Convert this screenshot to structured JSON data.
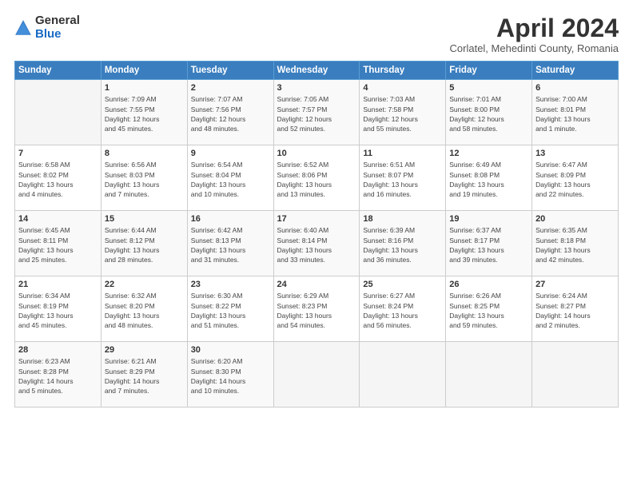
{
  "header": {
    "logo_general": "General",
    "logo_blue": "Blue",
    "title": "April 2024",
    "subtitle": "Corlatel, Mehedinti County, Romania"
  },
  "weekdays": [
    "Sunday",
    "Monday",
    "Tuesday",
    "Wednesday",
    "Thursday",
    "Friday",
    "Saturday"
  ],
  "weeks": [
    [
      {
        "day": "",
        "info": ""
      },
      {
        "day": "1",
        "info": "Sunrise: 7:09 AM\nSunset: 7:55 PM\nDaylight: 12 hours\nand 45 minutes."
      },
      {
        "day": "2",
        "info": "Sunrise: 7:07 AM\nSunset: 7:56 PM\nDaylight: 12 hours\nand 48 minutes."
      },
      {
        "day": "3",
        "info": "Sunrise: 7:05 AM\nSunset: 7:57 PM\nDaylight: 12 hours\nand 52 minutes."
      },
      {
        "day": "4",
        "info": "Sunrise: 7:03 AM\nSunset: 7:58 PM\nDaylight: 12 hours\nand 55 minutes."
      },
      {
        "day": "5",
        "info": "Sunrise: 7:01 AM\nSunset: 8:00 PM\nDaylight: 12 hours\nand 58 minutes."
      },
      {
        "day": "6",
        "info": "Sunrise: 7:00 AM\nSunset: 8:01 PM\nDaylight: 13 hours\nand 1 minute."
      }
    ],
    [
      {
        "day": "7",
        "info": "Sunrise: 6:58 AM\nSunset: 8:02 PM\nDaylight: 13 hours\nand 4 minutes."
      },
      {
        "day": "8",
        "info": "Sunrise: 6:56 AM\nSunset: 8:03 PM\nDaylight: 13 hours\nand 7 minutes."
      },
      {
        "day": "9",
        "info": "Sunrise: 6:54 AM\nSunset: 8:04 PM\nDaylight: 13 hours\nand 10 minutes."
      },
      {
        "day": "10",
        "info": "Sunrise: 6:52 AM\nSunset: 8:06 PM\nDaylight: 13 hours\nand 13 minutes."
      },
      {
        "day": "11",
        "info": "Sunrise: 6:51 AM\nSunset: 8:07 PM\nDaylight: 13 hours\nand 16 minutes."
      },
      {
        "day": "12",
        "info": "Sunrise: 6:49 AM\nSunset: 8:08 PM\nDaylight: 13 hours\nand 19 minutes."
      },
      {
        "day": "13",
        "info": "Sunrise: 6:47 AM\nSunset: 8:09 PM\nDaylight: 13 hours\nand 22 minutes."
      }
    ],
    [
      {
        "day": "14",
        "info": "Sunrise: 6:45 AM\nSunset: 8:11 PM\nDaylight: 13 hours\nand 25 minutes."
      },
      {
        "day": "15",
        "info": "Sunrise: 6:44 AM\nSunset: 8:12 PM\nDaylight: 13 hours\nand 28 minutes."
      },
      {
        "day": "16",
        "info": "Sunrise: 6:42 AM\nSunset: 8:13 PM\nDaylight: 13 hours\nand 31 minutes."
      },
      {
        "day": "17",
        "info": "Sunrise: 6:40 AM\nSunset: 8:14 PM\nDaylight: 13 hours\nand 33 minutes."
      },
      {
        "day": "18",
        "info": "Sunrise: 6:39 AM\nSunset: 8:16 PM\nDaylight: 13 hours\nand 36 minutes."
      },
      {
        "day": "19",
        "info": "Sunrise: 6:37 AM\nSunset: 8:17 PM\nDaylight: 13 hours\nand 39 minutes."
      },
      {
        "day": "20",
        "info": "Sunrise: 6:35 AM\nSunset: 8:18 PM\nDaylight: 13 hours\nand 42 minutes."
      }
    ],
    [
      {
        "day": "21",
        "info": "Sunrise: 6:34 AM\nSunset: 8:19 PM\nDaylight: 13 hours\nand 45 minutes."
      },
      {
        "day": "22",
        "info": "Sunrise: 6:32 AM\nSunset: 8:20 PM\nDaylight: 13 hours\nand 48 minutes."
      },
      {
        "day": "23",
        "info": "Sunrise: 6:30 AM\nSunset: 8:22 PM\nDaylight: 13 hours\nand 51 minutes."
      },
      {
        "day": "24",
        "info": "Sunrise: 6:29 AM\nSunset: 8:23 PM\nDaylight: 13 hours\nand 54 minutes."
      },
      {
        "day": "25",
        "info": "Sunrise: 6:27 AM\nSunset: 8:24 PM\nDaylight: 13 hours\nand 56 minutes."
      },
      {
        "day": "26",
        "info": "Sunrise: 6:26 AM\nSunset: 8:25 PM\nDaylight: 13 hours\nand 59 minutes."
      },
      {
        "day": "27",
        "info": "Sunrise: 6:24 AM\nSunset: 8:27 PM\nDaylight: 14 hours\nand 2 minutes."
      }
    ],
    [
      {
        "day": "28",
        "info": "Sunrise: 6:23 AM\nSunset: 8:28 PM\nDaylight: 14 hours\nand 5 minutes."
      },
      {
        "day": "29",
        "info": "Sunrise: 6:21 AM\nSunset: 8:29 PM\nDaylight: 14 hours\nand 7 minutes."
      },
      {
        "day": "30",
        "info": "Sunrise: 6:20 AM\nSunset: 8:30 PM\nDaylight: 14 hours\nand 10 minutes."
      },
      {
        "day": "",
        "info": ""
      },
      {
        "day": "",
        "info": ""
      },
      {
        "day": "",
        "info": ""
      },
      {
        "day": "",
        "info": ""
      }
    ]
  ]
}
